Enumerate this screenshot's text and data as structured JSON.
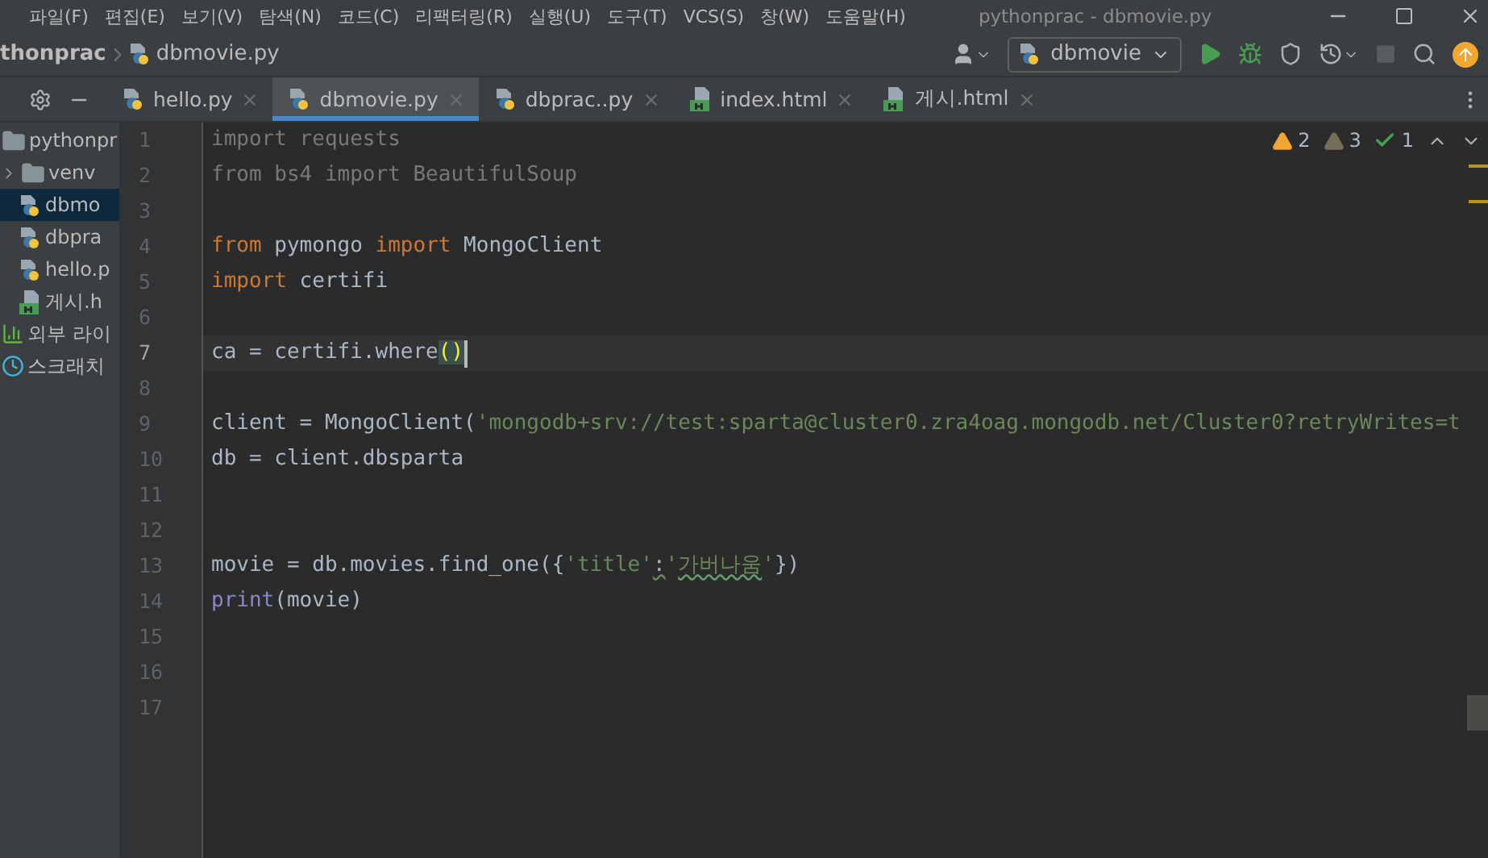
{
  "menu_bar": {
    "menus": [
      "파일(F)",
      "편집(E)",
      "보기(V)",
      "탐색(N)",
      "코드(C)",
      "리팩터링(R)",
      "실행(U)",
      "도구(T)",
      "VCS(S)",
      "창(W)",
      "도움말(H)"
    ],
    "window_title": "pythonprac - dbmovie.py"
  },
  "breadcrumb": [
    "thonprac",
    "dbmovie.py"
  ],
  "run_configuration": "dbmovie",
  "tabs": [
    {
      "label": "hello.py",
      "kind": "python",
      "selected": false
    },
    {
      "label": "dbmovie.py",
      "kind": "python",
      "selected": true
    },
    {
      "label": "dbprac..py",
      "kind": "python",
      "selected": false
    },
    {
      "label": "index.html",
      "kind": "html",
      "selected": false
    },
    {
      "label": "게시.html",
      "kind": "html",
      "selected": false
    }
  ],
  "project_tree": [
    {
      "label": "pythonpr",
      "kind": "folder",
      "selected": false,
      "expanded": true,
      "children": [
        {
          "label": "venv",
          "kind": "folder",
          "selected": false,
          "expanded": false
        },
        {
          "label": "dbmo",
          "kind": "python",
          "selected": true
        },
        {
          "label": "dbpra",
          "kind": "python",
          "selected": false
        },
        {
          "label": "hello.p",
          "kind": "python",
          "selected": false
        },
        {
          "label": "게시.h",
          "kind": "html",
          "selected": false
        }
      ]
    },
    {
      "label": "외부 라이",
      "kind": "library",
      "selected": false
    },
    {
      "label": "스크래치",
      "kind": "scratch",
      "selected": false
    }
  ],
  "inspections": [
    {
      "kind": "warning",
      "count": "2"
    },
    {
      "kind": "weak_warning",
      "count": "3"
    },
    {
      "kind": "typo",
      "count": "1"
    }
  ],
  "editor": {
    "lines": [
      {
        "number": "1",
        "current": false,
        "tokens": [
          {
            "text": "import requests",
            "kind": "unused"
          }
        ]
      },
      {
        "number": "2",
        "current": false,
        "tokens": [
          {
            "text": "from bs4 import BeautifulSoup",
            "kind": "unused"
          }
        ]
      },
      {
        "number": "3",
        "current": false
      },
      {
        "number": "4",
        "current": false,
        "tokens": [
          {
            "text": "from",
            "kind": "keyword"
          },
          {
            "text": " pymongo ",
            "kind": "plain"
          },
          {
            "text": "import",
            "kind": "keyword"
          },
          {
            "text": " MongoClient",
            "kind": "plain"
          }
        ]
      },
      {
        "number": "5",
        "current": false,
        "tokens": [
          {
            "text": "import",
            "kind": "keyword"
          },
          {
            "text": " certifi",
            "kind": "plain"
          }
        ]
      },
      {
        "number": "6",
        "current": false
      },
      {
        "number": "7",
        "current": true,
        "tokens": [
          {
            "text": "ca = certifi.where",
            "kind": "plain"
          },
          {
            "text": "()",
            "kind": "brace"
          }
        ]
      },
      {
        "number": "8",
        "current": false
      },
      {
        "number": "9",
        "current": false,
        "tokens": [
          {
            "text": "client = MongoClient(",
            "kind": "plain"
          },
          {
            "text": "'mongodb+srv://test:sparta@cluster0.zra4oag.mongodb.net/Cluster0?retryWrites=t",
            "kind": "string"
          }
        ]
      },
      {
        "number": "10",
        "current": false,
        "tokens": [
          {
            "text": "db = client.dbsparta",
            "kind": "plain"
          }
        ]
      },
      {
        "number": "11",
        "current": false
      },
      {
        "number": "12",
        "current": false
      },
      {
        "number": "13",
        "current": false,
        "tokens": [
          {
            "text": "movie = db.movies.find_one({",
            "kind": "plain"
          },
          {
            "text": "'title'",
            "kind": "string"
          },
          {
            "text": ":",
            "kind": "weak"
          },
          {
            "text": "'",
            "kind": "string"
          },
          {
            "text": "가버나움",
            "kind": "typo"
          },
          {
            "text": "'",
            "kind": "string"
          },
          {
            "text": "})",
            "kind": "plain"
          }
        ]
      },
      {
        "number": "14",
        "current": false,
        "tokens": [
          {
            "text": "print",
            "kind": "builtin"
          },
          {
            "text": "(movie)",
            "kind": "plain"
          }
        ]
      },
      {
        "number": "15",
        "current": false
      },
      {
        "number": "16",
        "current": false
      },
      {
        "number": "17",
        "current": false
      }
    ]
  }
}
